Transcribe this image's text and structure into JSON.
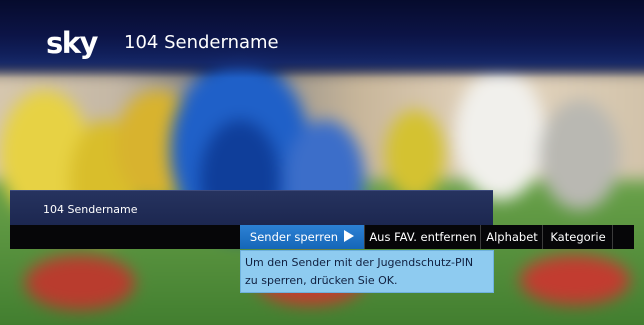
{
  "header": {
    "logo": "sky",
    "channel_title": "104 Sendername"
  },
  "channel_bar": {
    "channel_name": "104 Sendername"
  },
  "menu": {
    "items": [
      {
        "label": "Sender sperren",
        "selected": true
      },
      {
        "label": "Aus FAV. entfernen",
        "selected": false
      },
      {
        "label": "Alphabet",
        "selected": false
      },
      {
        "label": "Kategorie",
        "selected": false
      }
    ]
  },
  "tooltip": {
    "text": "Um den Sender mit der Jugendschutz-PIN zu sperren, drücken Sie OK."
  },
  "colors": {
    "header_bg": "#0c1446",
    "selected_item": "#1f73c8",
    "tooltip_bg": "#8ecbf0"
  }
}
